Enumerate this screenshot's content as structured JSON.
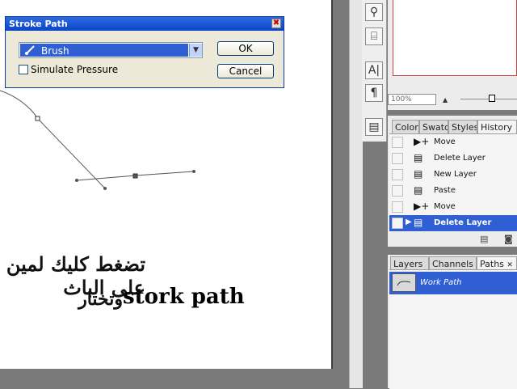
{
  "dialog": {
    "title": "Stroke Path",
    "close_glyph": "✖",
    "tool_value": "Brush",
    "simulate_pressure_label": "Simulate Pressure",
    "ok_label": "OK",
    "cancel_label": "Cancel"
  },
  "canvas_text": {
    "arabic_line1": "تضغط كليك لمين على الباث",
    "arabic_line2": "وتختار",
    "english": "stork path"
  },
  "toolbar": {
    "icons": [
      "pen-icon",
      "path-selection-icon",
      "type-icon",
      "paragraph-icon",
      "history-brush-icon"
    ],
    "glyphs": [
      "⚲",
      "⌸",
      "A|",
      "¶",
      "▤"
    ]
  },
  "navigator": {
    "zoom_value": "100%",
    "zoom_small_glyph": "▲",
    "zoom_position": 0.55
  },
  "history_panel": {
    "tabs": [
      {
        "label": "Color"
      },
      {
        "label": "Swatc"
      },
      {
        "label": "Styles"
      },
      {
        "label": "History"
      }
    ],
    "close_glyph": "✕",
    "items": [
      {
        "label": "Move",
        "icon": "move-icon"
      },
      {
        "label": "Delete Layer",
        "icon": "layer-icon"
      },
      {
        "label": "New Layer",
        "icon": "layer-icon"
      },
      {
        "label": "Paste",
        "icon": "layer-icon"
      },
      {
        "label": "Move",
        "icon": "move-icon"
      },
      {
        "label": "Delete Layer",
        "icon": "layer-icon"
      }
    ],
    "selected_index": 5
  },
  "layers_panel": {
    "tabs": [
      {
        "label": "Layers"
      },
      {
        "label": "Channels"
      },
      {
        "label": "Paths"
      }
    ],
    "close_glyph": "✕",
    "path_name": "Work Path"
  }
}
